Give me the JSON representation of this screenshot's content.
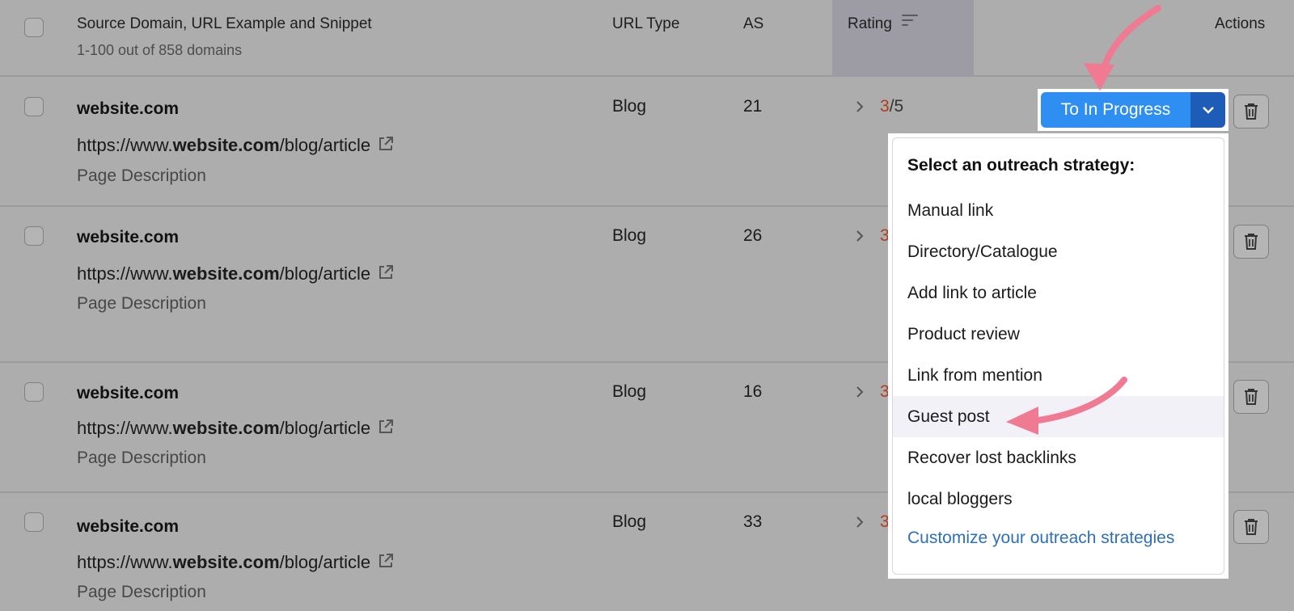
{
  "header": {
    "source_col": "Source Domain, URL Example and Snippet",
    "source_sub": "1-100 out of 858 domains",
    "url_type_col": "URL Type",
    "as_col": "AS",
    "rating_col": "Rating",
    "actions_col": "Actions"
  },
  "rows": [
    {
      "domain": "website.com",
      "url_prefix": "https://www.",
      "url_domain": "website.com",
      "url_suffix": "/blog/article",
      "description": "Page Description",
      "url_type": "Blog",
      "as": "21",
      "rating_value": "3",
      "rating_max": "/5"
    },
    {
      "domain": "website.com",
      "url_prefix": "https://www.",
      "url_domain": "website.com",
      "url_suffix": "/blog/article",
      "description": "Page Description",
      "url_type": "Blog",
      "as": "26",
      "rating_value": "3"
    },
    {
      "domain": "website.com",
      "url_prefix": "https://www.",
      "url_domain": "website.com",
      "url_suffix": "/blog/article",
      "description": "Page Description",
      "url_type": "Blog",
      "as": "16",
      "rating_value": "3"
    },
    {
      "domain": "website.com",
      "url_prefix": "https://www.",
      "url_domain": "website.com",
      "url_suffix": "/blog/article",
      "description": "Page Description",
      "url_type": "Blog",
      "as": "33",
      "rating_value": "3"
    }
  ],
  "action_button": {
    "label": "To In Progress"
  },
  "dropdown": {
    "title": "Select an outreach strategy:",
    "items": [
      "Manual link",
      "Directory/Catalogue",
      "Add link to article",
      "Product review",
      "Link from mention",
      "Guest post",
      "Recover lost backlinks",
      "local bloggers"
    ],
    "highlighted": "Guest post",
    "customize_link": "Customize your outreach strategies"
  },
  "colors": {
    "primary_button": "#2f8ef2",
    "primary_button_dark": "#1e5db7",
    "rating_accent": "#b23b1e",
    "link": "#2e6fb7",
    "annotation_arrow": "#f07a92"
  }
}
